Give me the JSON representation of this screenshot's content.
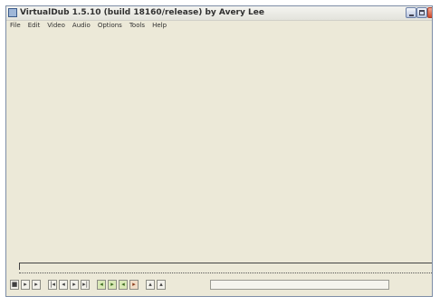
{
  "window": {
    "title": "VirtualDub 1.5.10 (build 18160/release) by Avery Lee",
    "controls": [
      "minimize",
      "maximize",
      "close"
    ]
  },
  "menubar": {
    "items": [
      {
        "label": "File"
      },
      {
        "label": "Edit"
      },
      {
        "label": "Video"
      },
      {
        "label": "Audio"
      },
      {
        "label": "Options"
      },
      {
        "label": "Tools"
      },
      {
        "label": "Help"
      }
    ]
  },
  "toolbar": {
    "buttons": [
      {
        "icon": "stop-icon",
        "glyph": "■"
      },
      {
        "icon": "play-input-icon",
        "glyph": "▸"
      },
      {
        "icon": "play-output-icon",
        "glyph": "▸"
      },
      {
        "icon": "start-icon",
        "glyph": "|◂"
      },
      {
        "icon": "back-icon",
        "glyph": "◂"
      },
      {
        "icon": "forward-icon",
        "glyph": "▸"
      },
      {
        "icon": "end-icon",
        "glyph": "▸|"
      },
      {
        "icon": "prev-keyframe-icon",
        "glyph": "◂"
      },
      {
        "icon": "next-keyframe-icon",
        "glyph": "▸"
      },
      {
        "icon": "scene-back-icon",
        "glyph": "◂"
      },
      {
        "icon": "scene-forward-icon",
        "glyph": "▸"
      },
      {
        "icon": "mark-in-icon",
        "glyph": "▴"
      },
      {
        "icon": "mark-out-icon",
        "glyph": "▴"
      }
    ]
  },
  "colors": {
    "face": "#ece9d8",
    "frame": "#7d8da6",
    "close": "#cf4b2c"
  }
}
